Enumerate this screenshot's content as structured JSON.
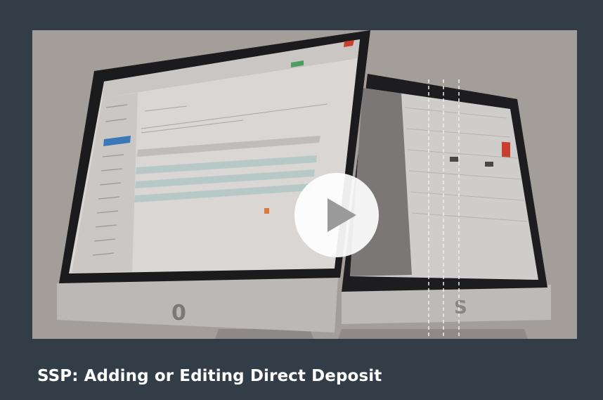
{
  "video": {
    "title": "SSP: Adding or Editing Direct Deposit",
    "thumbnail_subject": "two desktop monitors showing a web application",
    "play_icon": "play-icon"
  },
  "colors": {
    "background": "#333d48",
    "title_text": "#ffffff",
    "thumbnail_backdrop": "#a19b98",
    "play_circle": "#ffffff",
    "play_triangle": "#9a9a9a"
  }
}
